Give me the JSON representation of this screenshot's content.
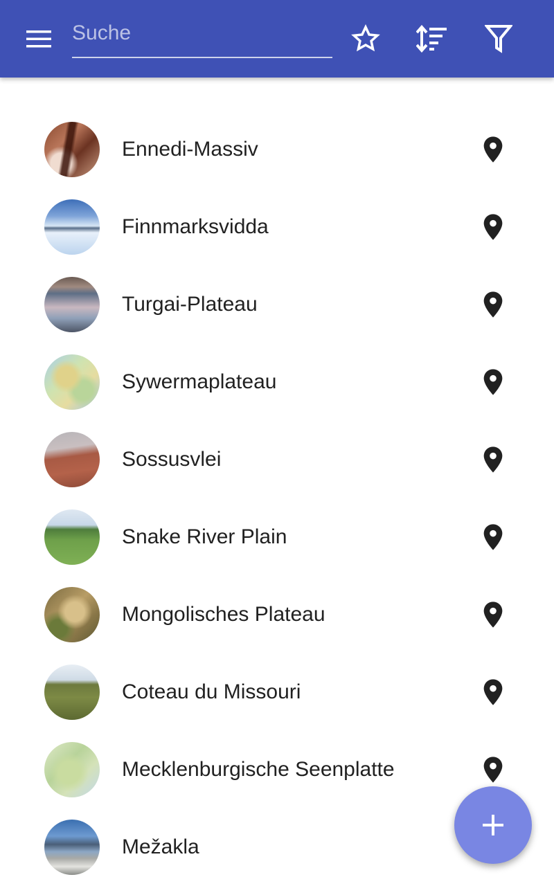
{
  "header": {
    "menu_icon": "hamburger-menu-icon",
    "search_placeholder": "Suche",
    "search_value": "",
    "actions": [
      {
        "icon": "star-outline-icon"
      },
      {
        "icon": "sort-icon"
      },
      {
        "icon": "filter-icon"
      }
    ],
    "background_color": "#3f51b5"
  },
  "places": [
    {
      "name": "Ennedi-Massiv",
      "thumbnail": "canyon-photo"
    },
    {
      "name": "Finnmarksvidda",
      "thumbnail": "snow-landscape-photo"
    },
    {
      "name": "Turgai-Plateau",
      "thumbnail": "water-sky-reflection-photo"
    },
    {
      "name": "Sywermaplateau",
      "thumbnail": "map-thumbnail"
    },
    {
      "name": "Sossusvlei",
      "thumbnail": "red-dunes-photo"
    },
    {
      "name": "Snake River Plain",
      "thumbnail": "green-plain-photo"
    },
    {
      "name": "Mongolisches Plateau",
      "thumbnail": "satellite-map-thumbnail"
    },
    {
      "name": "Coteau du Missouri",
      "thumbnail": "grassland-photo"
    },
    {
      "name": "Mecklenburgische Seenplatte",
      "thumbnail": "green-map-thumbnail"
    },
    {
      "name": "Mežakla",
      "thumbnail": "mountain-lake-photo"
    }
  ],
  "row_action_icon": "map-pin-icon",
  "fab": {
    "icon": "plus-icon",
    "color": "#7986e3"
  }
}
